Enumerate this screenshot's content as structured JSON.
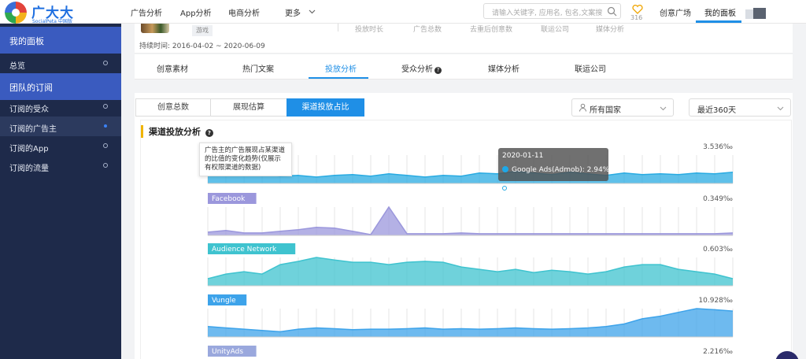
{
  "brand": {
    "name": "广大大",
    "subtitle": "SocialPeta 中国版"
  },
  "nav": {
    "items": [
      "广告分析",
      "App分析",
      "电商分析",
      "更多"
    ]
  },
  "search": {
    "placeholder": "请输入关键字, 应用名, 包名,文案搜"
  },
  "favorites": {
    "count": "316"
  },
  "header_links": {
    "creative_square": "创意广场",
    "my_dashboard": "我的面板"
  },
  "sidebar": {
    "group1": "我的面板",
    "overview": "总览",
    "group2": "团队的订阅",
    "items": [
      "订阅的受众",
      "订阅的广告主",
      "订阅的App",
      "订阅的流量"
    ],
    "active_index": 1
  },
  "info": {
    "tag": "游戏",
    "duration": "持续时间: 2016-04-02 ~ 2020-06-09",
    "stat_heads": [
      "投放时长",
      "广告总数",
      "去重后创意数",
      "联运公司",
      "媒体分析"
    ]
  },
  "main_tabs": {
    "items": [
      "创意素材",
      "热门文案",
      "投放分析",
      "受众分析",
      "媒体分析",
      "联运公司"
    ],
    "active_index": 2
  },
  "sub_tabs": {
    "items": [
      "创意总数",
      "展现估算",
      "渠道投放占比"
    ],
    "active_index": 2
  },
  "filters": {
    "country": "所有国家",
    "range": "最近360天"
  },
  "chart_section": {
    "title": "渠道投放分析",
    "help_text": "广告主的广告展现占某渠道的比值的变化趋势(仅展示有权限渠道的数据)"
  },
  "tooltip": {
    "date": "2020-01-11",
    "series": "Google Ads(Admob)",
    "value": "2.94‰"
  },
  "colors": {
    "accent": "#1f8fe6",
    "sidebar_bg": "#1e2a4a",
    "sidebar_group": "#3a5bbf",
    "title_bar": "#f0b400"
  },
  "chart_data": [
    {
      "type": "area",
      "series": [
        {
          "name": "Google Ads(Admob)",
          "max_label": "3.536‰",
          "color": "#29abe2",
          "values": [
            3.536,
            1.0,
            1.4,
            1.2,
            0.9,
            1.0,
            0.8,
            1.0,
            1.1,
            0.9,
            1.2,
            1.0,
            0.8,
            1.0,
            0.9,
            1.3,
            1.2,
            1.5,
            1.3,
            1.1,
            1.4,
            1.2,
            1.0,
            1.3,
            1.1,
            1.2,
            1.1,
            1.3,
            1.2,
            1.4
          ]
        }
      ]
    },
    {
      "type": "area",
      "series": [
        {
          "name": "Facebook",
          "max_label": "0.349‰",
          "color": "#9b97dc",
          "values": [
            0.04,
            0.06,
            0.03,
            0.03,
            0.05,
            0.07,
            0.1,
            0.09,
            0.05,
            0.01,
            0.349,
            0.02,
            0.02,
            0.02,
            0.03,
            0.02,
            0.02,
            0.02,
            0.02,
            0.02,
            0.02,
            0.02,
            0.02,
            0.02,
            0.02,
            0.02,
            0.02,
            0.02,
            0.02,
            0.03
          ]
        }
      ]
    },
    {
      "type": "area",
      "series": [
        {
          "name": "Audience Network",
          "max_label": "0.603‰",
          "color": "#3fc3cf",
          "values": [
            0.15,
            0.25,
            0.3,
            0.25,
            0.45,
            0.52,
            0.603,
            0.55,
            0.5,
            0.5,
            0.45,
            0.5,
            0.52,
            0.5,
            0.4,
            0.35,
            0.3,
            0.35,
            0.28,
            0.33,
            0.3,
            0.25,
            0.3,
            0.4,
            0.45,
            0.45,
            0.35,
            0.3,
            0.25,
            0.15
          ]
        }
      ]
    },
    {
      "type": "area",
      "series": [
        {
          "name": "Vungle",
          "max_label": "10.928‰",
          "color": "#3da3ea",
          "values": [
            4.0,
            3.5,
            3.0,
            2.5,
            2.0,
            3.0,
            3.5,
            3.2,
            2.8,
            3.0,
            3.0,
            3.2,
            3.5,
            3.0,
            3.2,
            3.0,
            3.2,
            3.5,
            3.2,
            3.0,
            3.2,
            3.5,
            4.0,
            5.0,
            7.0,
            8.0,
            9.5,
            10.928,
            10.5,
            10.0
          ]
        }
      ]
    },
    {
      "type": "area",
      "series": [
        {
          "name": "UnityAds",
          "max_label": "2.216‰",
          "color": "#5b8ff9",
          "values": []
        }
      ]
    }
  ]
}
